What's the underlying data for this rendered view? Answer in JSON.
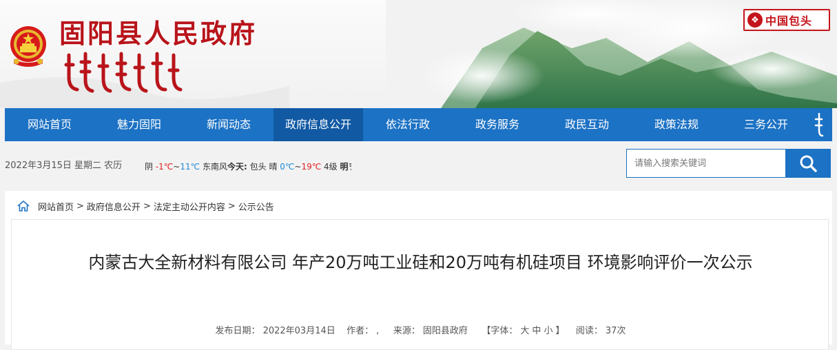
{
  "header": {
    "site_title": "固阳县人民政府",
    "badge_text": "中国包头"
  },
  "nav": {
    "items": [
      "网站首页",
      "魅力固阳",
      "新闻动态",
      "政府信息公开",
      "依法行政",
      "政务服务",
      "政民互动",
      "政策法规",
      "三务公开"
    ],
    "active_index": 3
  },
  "info": {
    "date": "2022年3月15日 星期二 农历",
    "weather": {
      "w1": "阴",
      "t1": "-1℃",
      "sep1": "~",
      "t2": "11℃",
      "wind": "东南风",
      "today_label": "今天:",
      "city": "包头",
      "w2": "晴",
      "t3": "0℃",
      "sep2": "~",
      "t4": "19℃",
      "level": "4级",
      "tail": "明ヲ"
    }
  },
  "search": {
    "placeholder": "请输入搜索关键词"
  },
  "breadcrumb": {
    "items": [
      "网站首页",
      "政府信息公开",
      "法定主动公开内容",
      "公示公告"
    ],
    "separator": ">"
  },
  "article": {
    "title": "内蒙古大全新材料有限公司 年产20万吨工业硅和20万吨有机硅项目 环境影响评价一次公示",
    "meta": {
      "date_label": "发布日期：",
      "date": "2022年03月14日",
      "author_label": "作者：",
      "author": ",",
      "source_label": "来源：",
      "source": "固阳县政府",
      "font_label": "【字体：",
      "font_large": "大",
      "font_medium": "中",
      "font_small": "小",
      "font_close": "】",
      "views_label": "阅读：",
      "views": "37次"
    }
  },
  "colors": {
    "brand_red": "#b8141a",
    "nav_blue": "#1c72c4",
    "nav_active": "#1159a3"
  }
}
